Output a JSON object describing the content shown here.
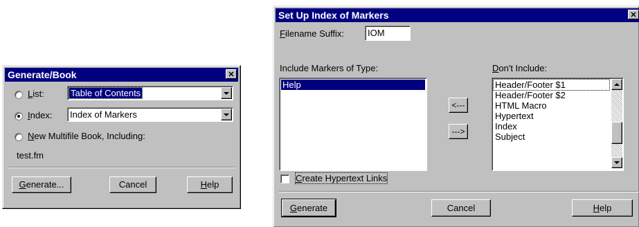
{
  "generate_dialog": {
    "title": "Generate/Book",
    "close_glyph": "✕",
    "list_label_u": "L",
    "list_label_rest": "ist:",
    "list_value": "Table of Contents",
    "index_label_u": "I",
    "index_label_rest": "ndex:",
    "index_value": "Index of Markers",
    "new_book_label_u": "N",
    "new_book_label_rest": "ew Multifile Book, Including:",
    "file_name": "test.fm",
    "generate_button_u": "G",
    "generate_button_rest": "enerate...",
    "cancel_button": "Cancel",
    "help_button_u": "H",
    "help_button_rest": "elp"
  },
  "index_dialog": {
    "title": "Set Up Index of Markers",
    "close_glyph": "✕",
    "suffix_label_u": "F",
    "suffix_label_rest": "ilename Suffix:",
    "suffix_value": "IOM",
    "include_label": "Include Markers of Type:",
    "include_items": [
      "Help"
    ],
    "dont_include_label_u": "D",
    "dont_include_label_rest": "on't Include:",
    "dont_include_items": [
      "Header/Footer $1",
      "Header/Footer $2",
      "HTML Macro",
      "Hypertext",
      "Index",
      "Subject"
    ],
    "move_left_button": "<---",
    "move_right_button": "--->",
    "hypertext_checkbox_u": "C",
    "hypertext_checkbox_rest": "reate Hypertext Links",
    "generate_button_u": "G",
    "generate_button_rest": "enerate",
    "cancel_button": "Cancel",
    "help_button_u": "H",
    "help_button_rest": "elp"
  },
  "colors": {
    "face": "#c0c0c0",
    "titlebar": "#000080",
    "selection": "#000080"
  }
}
